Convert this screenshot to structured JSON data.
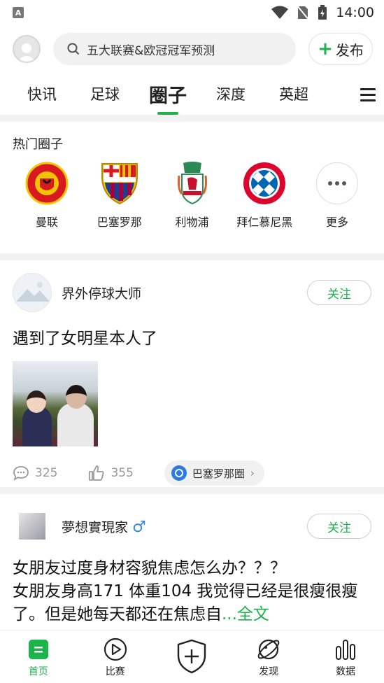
{
  "status_bar": {
    "time": "14:00",
    "app_badge": "A"
  },
  "header": {
    "search_placeholder": "五大联赛&欧冠冠军预测",
    "publish_label": "发布"
  },
  "tabs": [
    "快讯",
    "足球",
    "圈子",
    "深度",
    "英超"
  ],
  "active_tab": "圈子",
  "hot_circles": {
    "title": "热门圈子",
    "items": [
      {
        "name": "曼联",
        "icon": "man-utd-crest-icon"
      },
      {
        "name": "巴塞罗那",
        "icon": "barcelona-crest-icon"
      },
      {
        "name": "利物浦",
        "icon": "liverpool-crest-icon"
      },
      {
        "name": "拜仁慕尼黑",
        "icon": "bayern-crest-icon"
      },
      {
        "name": "更多",
        "icon": "more-dots-icon"
      }
    ]
  },
  "posts": [
    {
      "user": "界外停球大师",
      "follow_label": "关注",
      "title": "遇到了女明星本人了",
      "comments": "325",
      "likes": "355",
      "circle": "巴塞罗那圈"
    },
    {
      "user": "夢想實現家",
      "gender": "♂",
      "follow_label": "关注",
      "title": "女朋友过度身材容貌焦虑怎么办？？？",
      "body": "女朋友身高171 体重104 我觉得已经是很瘦很瘦了。但是她每天都还在焦虑自",
      "more": "...全文"
    }
  ],
  "bottom_nav": [
    {
      "label": "首页",
      "icon": "home-icon"
    },
    {
      "label": "比赛",
      "icon": "play-icon"
    },
    {
      "label": "",
      "icon": "add-shield-icon"
    },
    {
      "label": "发现",
      "icon": "discover-icon"
    },
    {
      "label": "数据",
      "icon": "stats-icon"
    }
  ],
  "colors": {
    "accent": "#1db34b"
  }
}
